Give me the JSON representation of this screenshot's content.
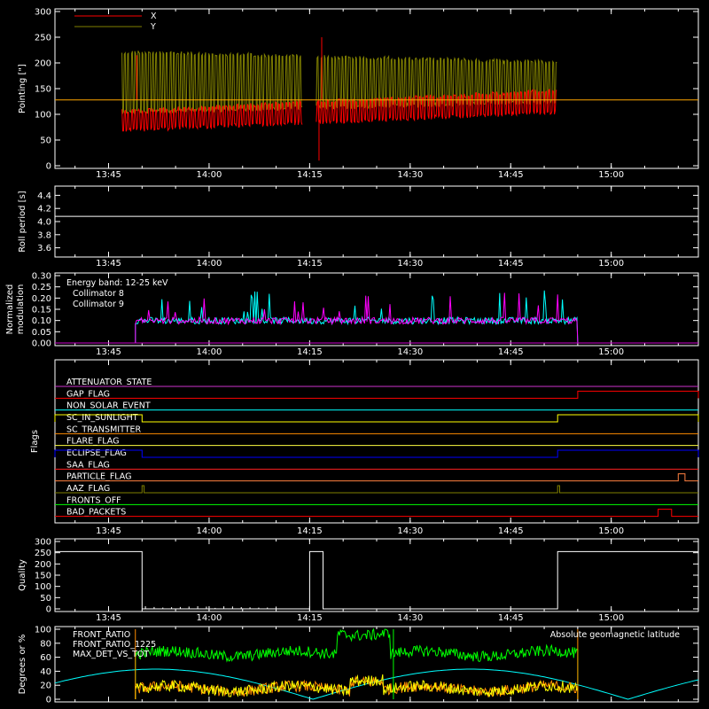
{
  "time_ticks": [
    "13:45",
    "14:00",
    "14:15",
    "14:30",
    "14:45",
    "15:00"
  ],
  "chart_data": [
    {
      "type": "line",
      "title": "",
      "ylabel": "Pointing [\"]",
      "ylim": [
        0,
        300
      ],
      "yticks": [
        0,
        50,
        100,
        150,
        200,
        250,
        300
      ],
      "xrange": [
        "13:37",
        "15:13"
      ],
      "legend": "top-left",
      "series": [
        {
          "name": "X",
          "color": "#ff0000",
          "gap": [
            "14:14",
            "14:16"
          ],
          "active": [
            "13:47",
            "14:52"
          ],
          "low": [
            65,
            100
          ],
          "high": [
            110,
            150
          ]
        },
        {
          "name": "Y",
          "color": "#808000",
          "gap": [
            "14:14",
            "14:16"
          ],
          "active": [
            "13:47",
            "14:52"
          ],
          "low": [
            100,
            120
          ],
          "high": [
            225,
            205
          ]
        }
      ],
      "reference_line": {
        "value": 128,
        "color": "#ffa500"
      }
    },
    {
      "type": "line",
      "ylabel": "Roll period [s]",
      "ylim": [
        3.5,
        4.5
      ],
      "yticks": [
        "3.6",
        "3.8",
        "4.0",
        "4.2",
        "4.4"
      ],
      "series": [
        {
          "name": "",
          "color": "#ffffff",
          "value": 4.08
        }
      ]
    },
    {
      "type": "line",
      "ylabel": "Normalized modulation",
      "ylim": [
        0,
        0.3
      ],
      "yticks": [
        "0.00",
        "0.05",
        "0.10",
        "0.15",
        "0.20",
        "0.25",
        "0.30"
      ],
      "legend_header": "Energy band: 12-25 keV",
      "series": [
        {
          "name": "Collimator 8",
          "color": "#00ffff",
          "active": [
            "13:49",
            "14:55"
          ],
          "base": 0.095
        },
        {
          "name": "Collimator 9",
          "color": "#ff00ff",
          "active": [
            "13:49",
            "14:55"
          ],
          "base": 0.095
        }
      ]
    },
    {
      "type": "line",
      "ylabel": "Flags",
      "flags": [
        {
          "name": "ATTENUATOR_STATE",
          "color": "#cc33cc",
          "segments": []
        },
        {
          "name": "GAP_FLAG",
          "color": "#ff0000",
          "segments": [
            [
              "14:55",
              "15:13"
            ]
          ]
        },
        {
          "name": "NON_SOLAR_EVENT",
          "color": "#00ffff",
          "segments": []
        },
        {
          "name": "SC_IN_SUNLIGHT",
          "color": "#ffff00",
          "segments": [
            [
              "13:37",
              "13:50"
            ],
            [
              "14:52",
              "15:13"
            ]
          ]
        },
        {
          "name": "SC_TRANSMITTER",
          "color": "#ff8c00",
          "segments": []
        },
        {
          "name": "FLARE_FLAG",
          "color": "#ffff40",
          "segments": []
        },
        {
          "name": "ECLIPSE_FLAG",
          "color": "#0000ff",
          "segments": [
            [
              "13:37",
              "13:50"
            ],
            [
              "14:52",
              "15:13"
            ]
          ]
        },
        {
          "name": "SAA_FLAG",
          "color": "#ff2020",
          "segments": []
        },
        {
          "name": "PARTICLE_FLAG",
          "color": "#ff8040",
          "segments": [
            [
              "15:10",
              "15:11"
            ]
          ]
        },
        {
          "name": "AAZ_FLAG",
          "color": "#808000",
          "segments": [
            [
              "13:50",
              "13:50.3"
            ],
            [
              "14:52",
              "14:52.3"
            ]
          ]
        },
        {
          "name": "FRONTS_OFF",
          "color": "#00ff00",
          "segments": []
        },
        {
          "name": "BAD_PACKETS",
          "color": "#ff0000",
          "segments": [
            [
              "15:07",
              "15:09"
            ]
          ]
        }
      ]
    },
    {
      "type": "line",
      "ylabel": "Quality",
      "ylim": [
        0,
        300
      ],
      "yticks": [
        0,
        50,
        100,
        150,
        200,
        250,
        300
      ],
      "series": [
        {
          "name": "",
          "color": "#ffffff",
          "segments": [
            [
              "13:37",
              "13:50",
              255
            ],
            [
              "14:15",
              "14:17",
              255
            ],
            [
              "14:52",
              "15:13",
              255
            ]
          ]
        }
      ]
    },
    {
      "type": "line",
      "ylabel": "Degrees or %",
      "ylim": [
        0,
        100
      ],
      "yticks": [
        0,
        20,
        40,
        60,
        80,
        100
      ],
      "legend": "top-left",
      "annotation": "Absolute geomagnetic latitude",
      "annotation_color": "#00ffff",
      "series": [
        {
          "name": "FRONT_RATIO",
          "color": "#ffff00",
          "active": [
            "13:49",
            "14:55"
          ],
          "level": 15,
          "high_window": [
            "14:21",
            "14:26"
          ],
          "high_level": 30
        },
        {
          "name": "FRONT_RATIO_1225",
          "color": "#00ff00",
          "active": [
            "13:49",
            "14:55"
          ],
          "level": 65,
          "high_window": [
            "14:19",
            "14:27"
          ],
          "high_level": 95
        },
        {
          "name": "MAX_DET_VS_TOT",
          "color": "#ff8c00",
          "active": [
            "13:49",
            "14:55"
          ],
          "level": 15,
          "high_window": [
            "14:21",
            "14:26"
          ],
          "high_level": 28
        },
        {
          "name": "Absolute geomagnetic latitude",
          "color": "#00ffff",
          "min": 0,
          "max": 43,
          "period_minutes": 47,
          "phase": "13:52"
        }
      ]
    }
  ]
}
